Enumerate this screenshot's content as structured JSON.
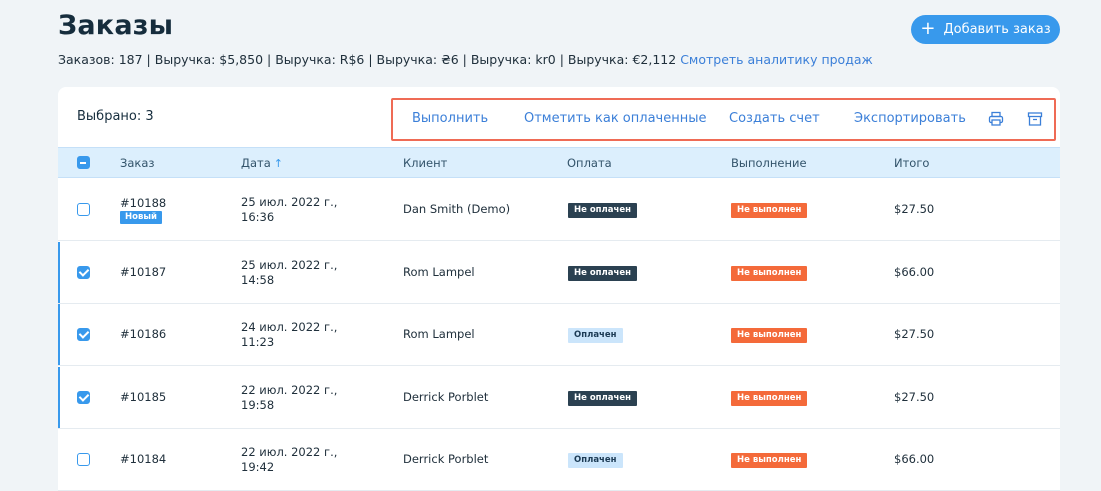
{
  "header": {
    "title": "Заказы",
    "stats": "Заказов: 187 | Выручка: $5,850 | Выручка: R$6 | Выручка: ₴6 | Выручка: kr0 | Выручка: €2,112",
    "analytics_link": "Смотреть аналитику продаж",
    "add_button": "Добавить заказ"
  },
  "toolbar": {
    "selected": "Выбрано: 3",
    "actions": [
      "Выполнить",
      "Отметить как оплаченные",
      "Создать счет",
      "Экспортировать"
    ],
    "icons": [
      "print-icon",
      "archive-icon"
    ]
  },
  "columns": [
    "Заказ",
    "Дата",
    "Клиент",
    "Оплата",
    "Выполнение",
    "Итого"
  ],
  "sort_indicator": "↑",
  "rows": [
    {
      "checked": false,
      "order": "#10188",
      "badge": "Новый",
      "date1": "25 июл. 2022 г.,",
      "date2": "16:36",
      "customer": "Dan Smith (Demo)",
      "payment": "Не оплачен",
      "payment_status": "unpaid",
      "fulfillment": "Не выполнен",
      "total": "$27.50"
    },
    {
      "checked": true,
      "order": "#10187",
      "badge": "",
      "date1": "25 июл. 2022 г.,",
      "date2": "14:58",
      "customer": "Rom Lampel",
      "payment": "Не оплачен",
      "payment_status": "unpaid",
      "fulfillment": "Не выполнен",
      "total": "$66.00"
    },
    {
      "checked": true,
      "order": "#10186",
      "badge": "",
      "date1": "24 июл. 2022 г.,",
      "date2": "11:23",
      "customer": "Rom Lampel",
      "payment": "Оплачен",
      "payment_status": "paid",
      "fulfillment": "Не выполнен",
      "total": "$27.50"
    },
    {
      "checked": true,
      "order": "#10185",
      "badge": "",
      "date1": "22 июл. 2022 г.,",
      "date2": "19:58",
      "customer": "Derrick Porblet",
      "payment": "Не оплачен",
      "payment_status": "unpaid",
      "fulfillment": "Не выполнен",
      "total": "$27.50"
    },
    {
      "checked": false,
      "order": "#10184",
      "badge": "",
      "date1": "22 июл. 2022 г.,",
      "date2": "19:42",
      "customer": "Derrick Porblet",
      "payment": "Оплачен",
      "payment_status": "paid",
      "fulfillment": "Не выполнен",
      "total": "$66.00"
    }
  ],
  "colors": {
    "accent": "#3899ec",
    "highlight": "#ef6b55",
    "unpaid": "#2b4151",
    "paid": "#cbe5fb",
    "unfulfilled": "#f46a3a"
  }
}
